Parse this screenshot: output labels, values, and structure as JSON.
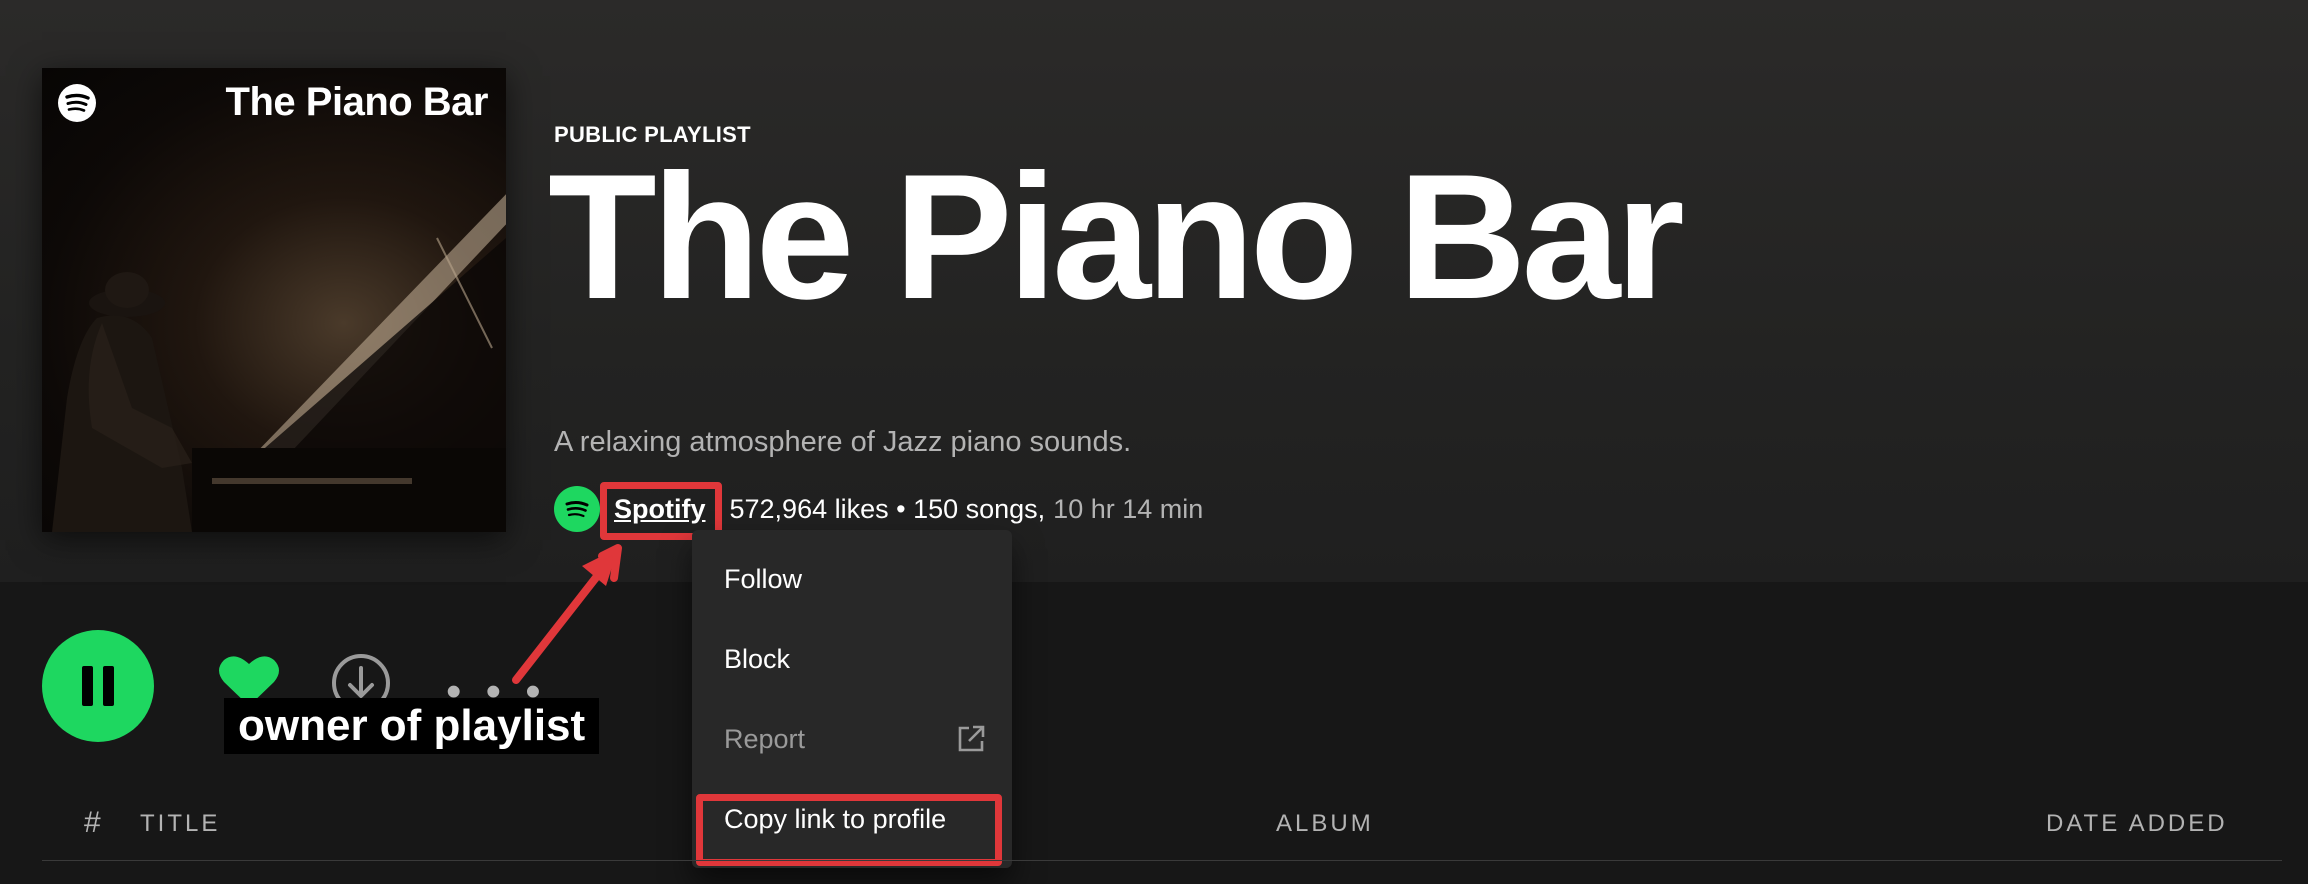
{
  "cover": {
    "title": "The Piano Bar",
    "logo_icon": "spotify-logo-icon"
  },
  "playlist": {
    "type_label": "PUBLIC PLAYLIST",
    "title": "The Piano Bar",
    "description": "A relaxing atmosphere of Jazz piano sounds.",
    "owner": "Spotify",
    "stats": "572,964 likes • 150 songs,",
    "duration": "10 hr 14 min"
  },
  "actions": {
    "play_state_icon": "pause-icon",
    "like_icon": "heart-icon",
    "download_icon": "download-icon",
    "more_label": "• • •"
  },
  "context_menu": {
    "items": [
      {
        "label": "Follow",
        "enabled": true
      },
      {
        "label": "Block",
        "enabled": true
      },
      {
        "label": "Report",
        "enabled": false,
        "icon": "external-link-icon"
      },
      {
        "label": "Copy link to profile",
        "enabled": true
      }
    ]
  },
  "annotation": {
    "label": "owner of playlist",
    "color": "#e0373a"
  },
  "tracklist": {
    "headers": {
      "number": "#",
      "title": "TITLE",
      "album": "ALBUM",
      "date_added": "DATE ADDED"
    }
  },
  "colors": {
    "accent": "#1ed760",
    "background": "#181818",
    "menu_bg": "#282828",
    "highlight": "#e0373a"
  }
}
